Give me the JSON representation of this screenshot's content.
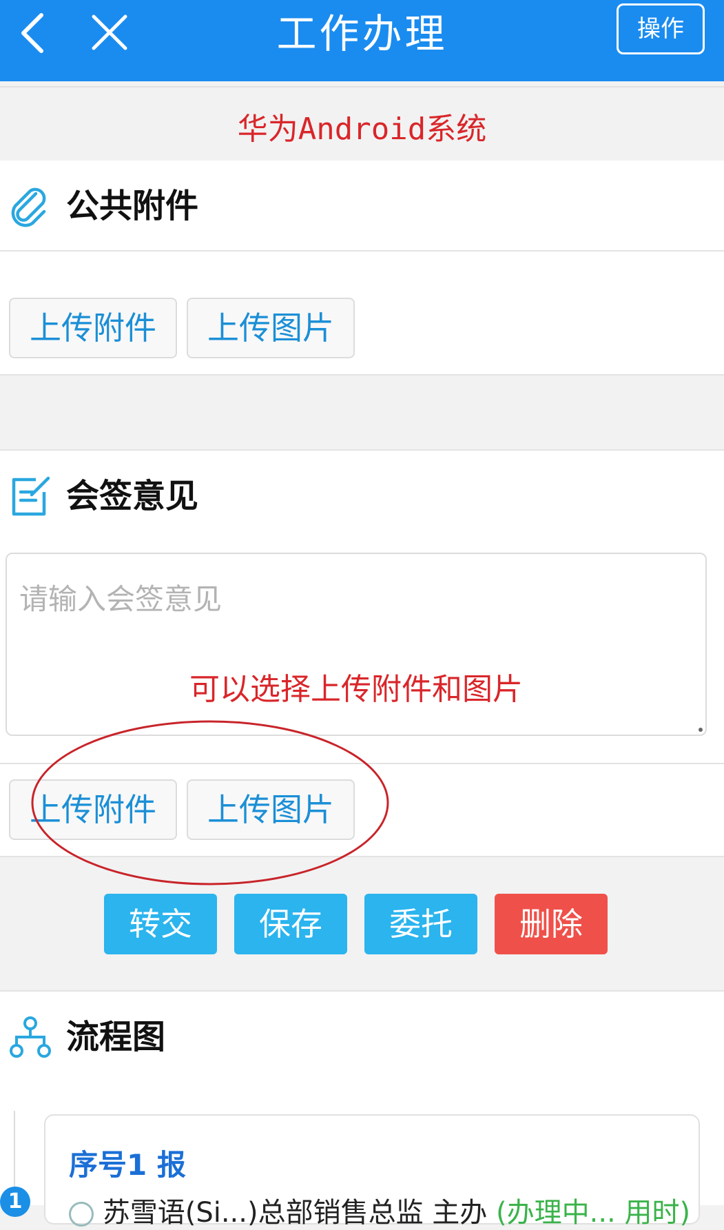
{
  "header": {
    "title": "工作办理",
    "operate_label": "操作"
  },
  "system_label": "华为Android系统",
  "attachments": {
    "title": "公共附件",
    "upload_file_label": "上传附件",
    "upload_image_label": "上传图片"
  },
  "countersign": {
    "title": "会签意见",
    "placeholder": "请输入会签意见",
    "hint": "可以选择上传附件和图片",
    "upload_file_label": "上传附件",
    "upload_image_label": "上传图片"
  },
  "actions": {
    "transfer_label": "转交",
    "save_label": "保存",
    "entrust_label": "委托",
    "delete_label": "删除",
    "primary_color": "#2bb4ee",
    "danger_color": "#f0504a"
  },
  "flowchart": {
    "title": "流程图",
    "steps": [
      {
        "badge": "1",
        "title": "序号1  报",
        "person": "苏雪语(Si...)总部销售总监 主办",
        "status": "(办理中... 用时)"
      }
    ]
  }
}
